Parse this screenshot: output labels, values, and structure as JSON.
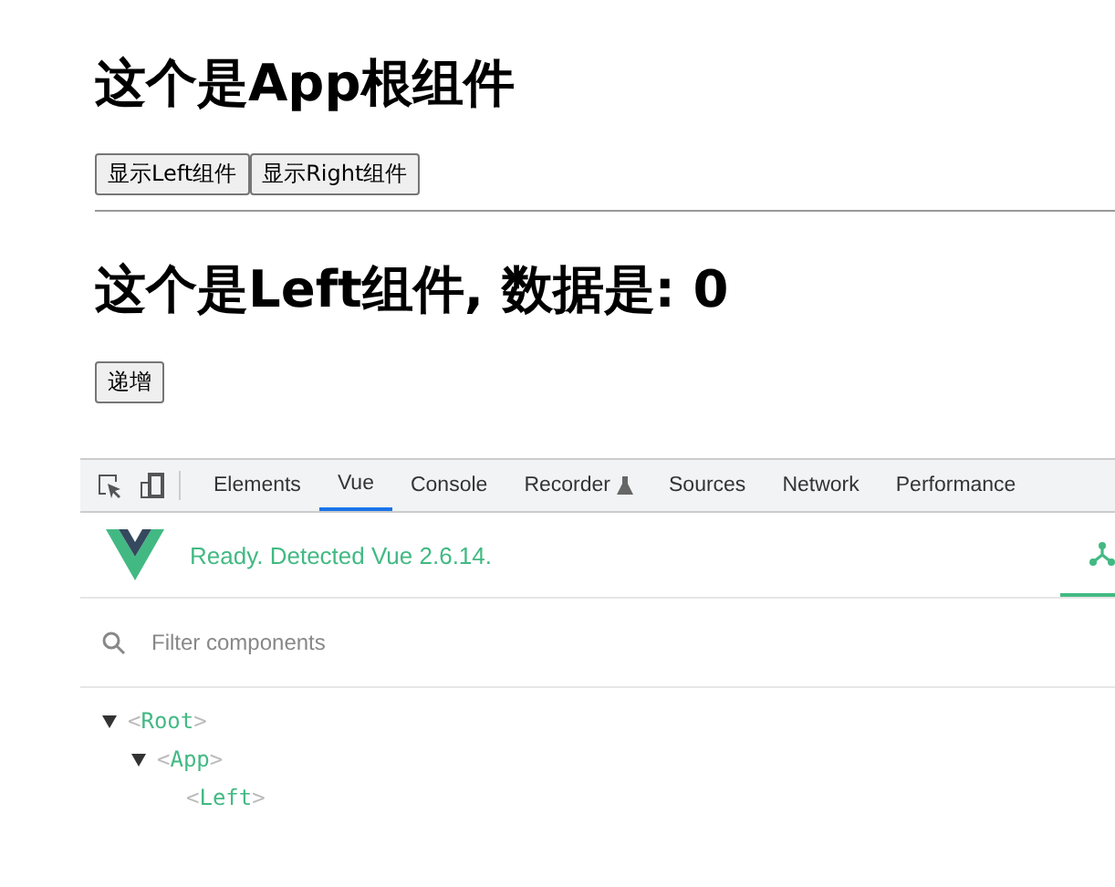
{
  "app": {
    "title": "这个是App根组件",
    "buttons": [
      "显示Left组件",
      "显示Right组件"
    ]
  },
  "left": {
    "title": "这个是Left组件, 数据是: 0",
    "button": "递增"
  },
  "devtools": {
    "tabs": [
      {
        "label": "Elements",
        "selected": false
      },
      {
        "label": "Vue",
        "selected": true
      },
      {
        "label": "Console",
        "selected": false
      },
      {
        "label": "Recorder",
        "selected": false,
        "kind": "experimental"
      },
      {
        "label": "Sources",
        "selected": false
      },
      {
        "label": "Network",
        "selected": false
      },
      {
        "label": "Performance",
        "selected": false
      }
    ],
    "status": "Ready. Detected Vue 2.6.14.",
    "filter": {
      "placeholder": "Filter components"
    },
    "tree": [
      {
        "name": "<Root>",
        "expanded": true,
        "children": [
          {
            "name": "<App>",
            "expanded": true,
            "children": [
              {
                "name": "<Left>"
              }
            ]
          }
        ]
      }
    ]
  }
}
